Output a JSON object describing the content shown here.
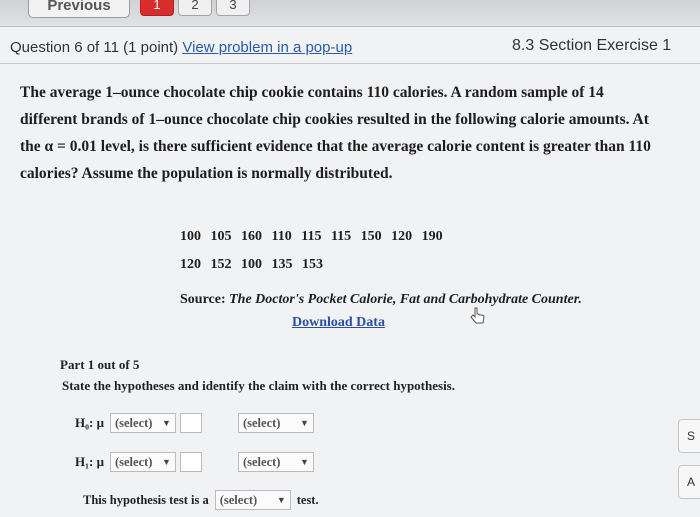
{
  "topbar": {
    "previous_label": "Previous",
    "nums": [
      "1",
      "2",
      "3"
    ]
  },
  "question": {
    "number_text": "Question 6 of 11 (1 point)",
    "popup_link": "View problem in a pop-up",
    "section": "8.3 Section Exercise 1",
    "problem_line1": "The average 1–ounce chocolate chip cookie contains 110 calories. A random sample of 14",
    "problem_line2": "different brands of 1–ounce chocolate chip cookies resulted in the following calorie amounts. At",
    "problem_line3_pre": "the α = 0.01 level, is there sufficient evidence that the average calorie content is greater than 110",
    "problem_line4": "calories? Assume the population is normally distributed.",
    "data_row1": "100 105 160 110 115 115 150 120 190",
    "data_row2": "120 152 100 135 153",
    "source_label": "Source:",
    "source_text": "The Doctor's Pocket Calorie, Fat and Carbohydrate Counter.",
    "download_label": "Download Data"
  },
  "part": {
    "progress": "Part 1 out of 5",
    "instruction": "State the hypotheses and identify the claim with the correct hypothesis.",
    "h0_label": "H₀: μ",
    "h1_label": "H₁: μ",
    "select_placeholder": "(select)",
    "test_prefix": "This hypothesis test is a",
    "test_suffix": "test."
  },
  "side": {
    "btn1": "S",
    "btn2": "A"
  },
  "colors": {
    "accent": "#d92d2d",
    "link": "#2a5aa8"
  }
}
